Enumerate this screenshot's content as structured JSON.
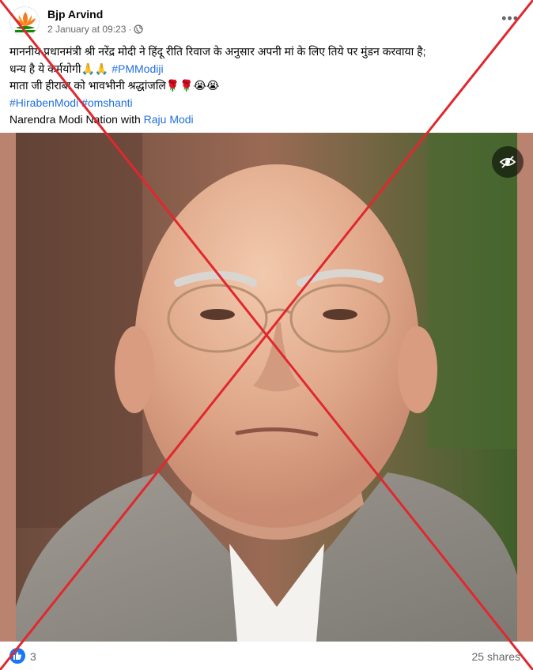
{
  "post": {
    "author": "Bjp Arvind",
    "timestamp": "2 January at 09:23",
    "visibility_icon": "globe-icon",
    "more_icon": "more-options-icon",
    "more_label": "•••",
    "caption": {
      "line1": "माननीय प्रधानमंत्री श्री नरेंद्र मोदी ने हिंदू रीति रिवाज के अनुसार अपनी मां के लिए तिये पर मुंडन करवाया है;",
      "line2_text": " धन्य है ये कर्मयोगी🙏🙏 ",
      "line2_hashtag": "#PMModiji",
      "line3": " माता जी हीराबा को भावभीनी श्रद्धांजलि🌹🌹😭😭",
      "hashtags": [
        "#HirabenModi",
        "#omshanti"
      ],
      "with_prefix": "Narendra Modi Nation with ",
      "with_name": "Raju Modi"
    },
    "photo_alt": "Edited photo of a bald man in glasses wearing a grey jacket",
    "hide_icon": "eye-slash-icon",
    "reactions": {
      "icon": "like-icon",
      "count": "3"
    },
    "shares": "25 shares"
  },
  "overlay": {
    "type": "red-cross",
    "color": "#e0282e"
  }
}
